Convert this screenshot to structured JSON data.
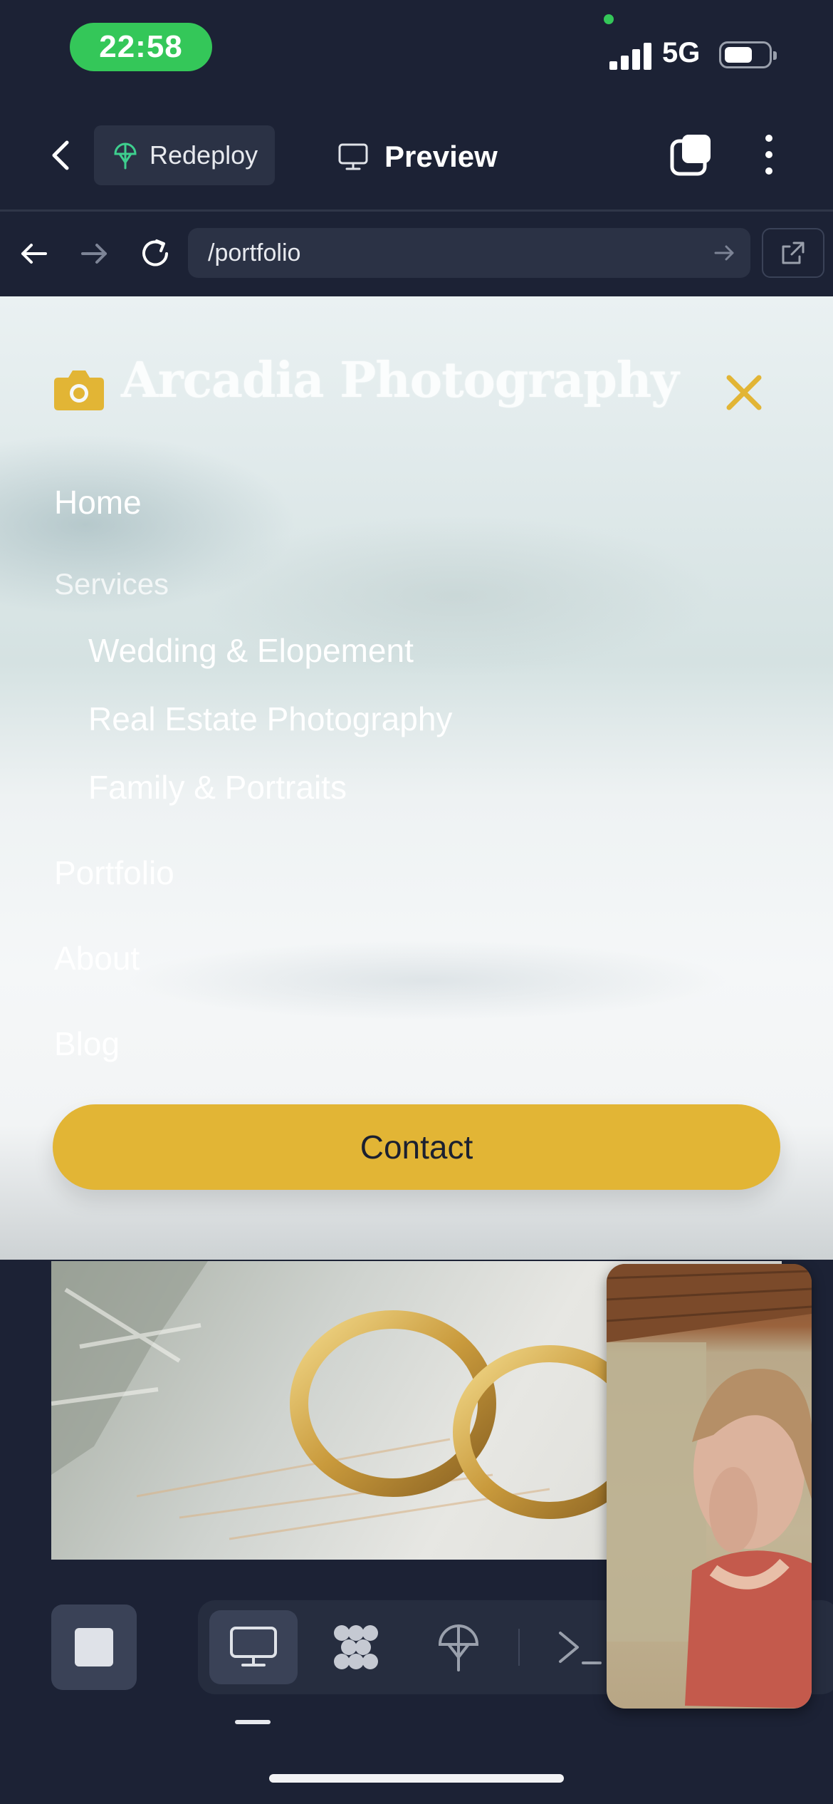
{
  "status_bar": {
    "time": "22:58",
    "network": "5G",
    "battery_level": 0.6,
    "signal_bars": 4
  },
  "app_toolbar": {
    "redeploy_label": "Redeploy",
    "preview_label": "Preview"
  },
  "browser": {
    "url": "/portfolio"
  },
  "site": {
    "brand": "Arcadia Photography",
    "menu": {
      "home": "Home",
      "services": "Services",
      "service_items": [
        "Wedding & Elopement",
        "Real Estate Photography",
        "Family & Portraits"
      ],
      "portfolio": "Portfolio",
      "about": "About",
      "blog": "Blog"
    },
    "contact_label": "Contact"
  },
  "bottom_bar": {
    "tools": [
      "webview-icon",
      "extensions-icon",
      "deploy-icon",
      "terminal-icon"
    ],
    "active_tool": "webview-icon"
  },
  "colors": {
    "background": "#1c2235",
    "accent": "#e2b535",
    "status_green": "#34c759",
    "deploy_green": "#3ecf8e"
  }
}
